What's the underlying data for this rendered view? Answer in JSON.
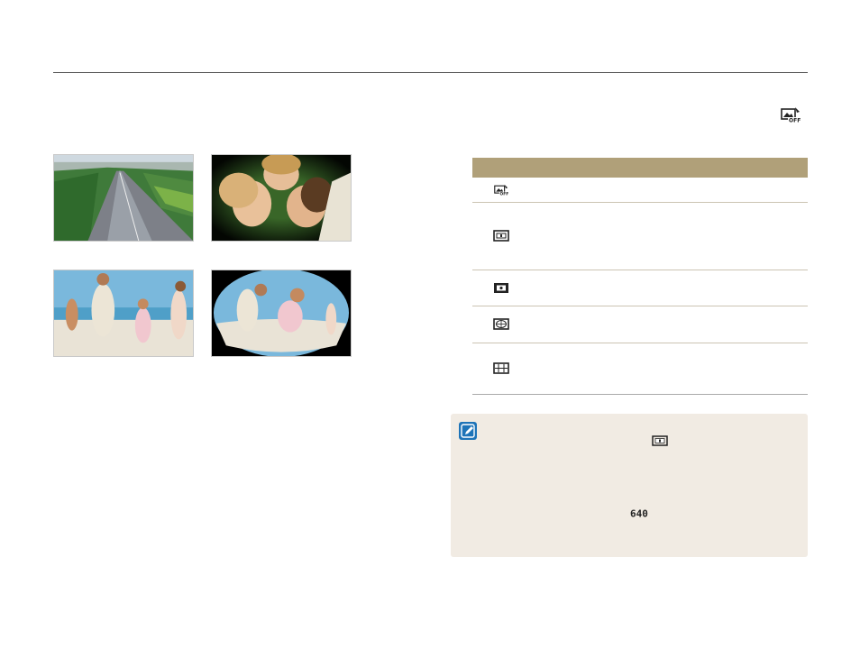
{
  "icons": {
    "header_effect": "lens-effect-off-icon",
    "note": "note-pencil-icon",
    "inline_frame": "frame-icon",
    "inline_resolution": "resolution-640-icon"
  },
  "table": {
    "header": [
      "",
      ""
    ],
    "rows": [
      {
        "icon": "lens-effect-off-icon",
        "text": ""
      },
      {
        "icon": "miniature-icon",
        "text": ""
      },
      {
        "icon": "vignetting-icon",
        "text": ""
      },
      {
        "icon": "fisheye-icon",
        "text": ""
      },
      {
        "icon": "wide-lens-icon",
        "text": ""
      }
    ]
  },
  "note": {
    "badge_resolution": "640"
  },
  "colors": {
    "table_header": "#b0a079",
    "note_bg": "#f1ebe3",
    "note_icon": "#1e74b8"
  }
}
